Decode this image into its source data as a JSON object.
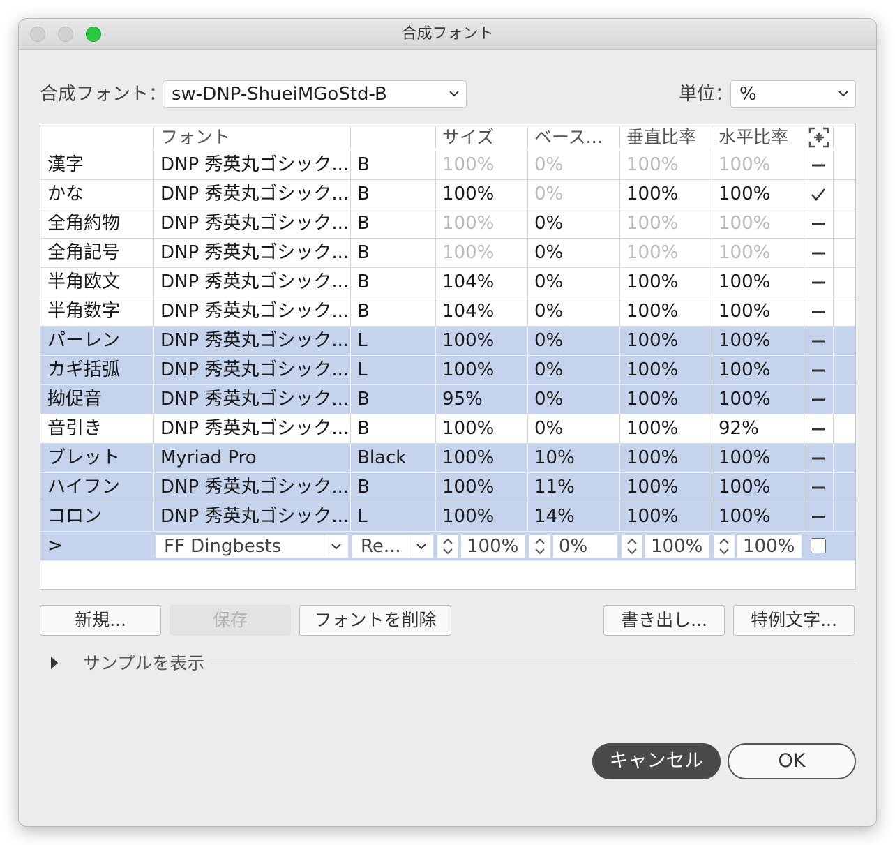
{
  "window": {
    "title": "合成フォント"
  },
  "top": {
    "composite_label": "合成フォント：",
    "composite_value": "sw-DNP-ShueiMGoStd-B",
    "unit_label": "単位：",
    "unit_value": "%"
  },
  "table": {
    "headers": [
      "",
      "フォント",
      "",
      "サイズ",
      "ベース...",
      "垂直比率",
      "水平比率"
    ],
    "rows": [
      {
        "name": "漢字",
        "font": "DNP 秀英丸ゴシック...",
        "style": "B",
        "size": "100%",
        "base": "0%",
        "vscale": "100%",
        "hscale": "100%",
        "mark": "dash",
        "size_dim": true,
        "base_dim": true,
        "vscale_dim": true,
        "hscale_dim": true,
        "selected": false
      },
      {
        "name": "かな",
        "font": "DNP 秀英丸ゴシック...",
        "style": "B",
        "size": "100%",
        "base": "0%",
        "vscale": "100%",
        "hscale": "100%",
        "mark": "check",
        "size_dim": false,
        "base_dim": true,
        "vscale_dim": false,
        "hscale_dim": false,
        "selected": false
      },
      {
        "name": "全角約物",
        "font": "DNP 秀英丸ゴシック...",
        "style": "B",
        "size": "100%",
        "base": "0%",
        "vscale": "100%",
        "hscale": "100%",
        "mark": "dash",
        "size_dim": true,
        "base_dim": false,
        "vscale_dim": true,
        "hscale_dim": true,
        "selected": false
      },
      {
        "name": "全角記号",
        "font": "DNP 秀英丸ゴシック...",
        "style": "B",
        "size": "100%",
        "base": "0%",
        "vscale": "100%",
        "hscale": "100%",
        "mark": "dash",
        "size_dim": true,
        "base_dim": false,
        "vscale_dim": true,
        "hscale_dim": true,
        "selected": false
      },
      {
        "name": "半角欧文",
        "font": "DNP 秀英丸ゴシック...",
        "style": "B",
        "size": "104%",
        "base": "0%",
        "vscale": "100%",
        "hscale": "100%",
        "mark": "dash",
        "size_dim": false,
        "base_dim": false,
        "vscale_dim": false,
        "hscale_dim": false,
        "selected": false
      },
      {
        "name": "半角数字",
        "font": "DNP 秀英丸ゴシック...",
        "style": "B",
        "size": "104%",
        "base": "0%",
        "vscale": "100%",
        "hscale": "100%",
        "mark": "dash",
        "size_dim": false,
        "base_dim": false,
        "vscale_dim": false,
        "hscale_dim": false,
        "selected": false
      },
      {
        "name": "パーレン",
        "font": "DNP 秀英丸ゴシック...",
        "style": "L",
        "size": "100%",
        "base": "0%",
        "vscale": "100%",
        "hscale": "100%",
        "mark": "dash",
        "size_dim": false,
        "base_dim": false,
        "vscale_dim": false,
        "hscale_dim": false,
        "selected": true
      },
      {
        "name": "カギ括弧",
        "font": "DNP 秀英丸ゴシック...",
        "style": "L",
        "size": "100%",
        "base": "0%",
        "vscale": "100%",
        "hscale": "100%",
        "mark": "dash",
        "size_dim": false,
        "base_dim": false,
        "vscale_dim": false,
        "hscale_dim": false,
        "selected": true
      },
      {
        "name": "拗促音",
        "font": "DNP 秀英丸ゴシック...",
        "style": "B",
        "size": "95%",
        "base": "0%",
        "vscale": "100%",
        "hscale": "100%",
        "mark": "dash",
        "size_dim": false,
        "base_dim": false,
        "vscale_dim": false,
        "hscale_dim": false,
        "selected": true
      },
      {
        "name": "音引き",
        "font": "DNP 秀英丸ゴシック...",
        "style": "B",
        "size": "100%",
        "base": "0%",
        "vscale": "100%",
        "hscale": "92%",
        "mark": "dash",
        "size_dim": false,
        "base_dim": false,
        "vscale_dim": false,
        "hscale_dim": false,
        "selected": false
      },
      {
        "name": "ブレット",
        "font": "Myriad Pro",
        "style": "Black",
        "size": "100%",
        "base": "10%",
        "vscale": "100%",
        "hscale": "100%",
        "mark": "dash",
        "size_dim": false,
        "base_dim": false,
        "vscale_dim": false,
        "hscale_dim": false,
        "selected": true
      },
      {
        "name": "ハイフン",
        "font": "DNP 秀英丸ゴシック...",
        "style": "B",
        "size": "100%",
        "base": "11%",
        "vscale": "100%",
        "hscale": "100%",
        "mark": "dash",
        "size_dim": false,
        "base_dim": false,
        "vscale_dim": false,
        "hscale_dim": false,
        "selected": true
      },
      {
        "name": "コロン",
        "font": "DNP 秀英丸ゴシック...",
        "style": "L",
        "size": "100%",
        "base": "14%",
        "vscale": "100%",
        "hscale": "100%",
        "mark": "dash",
        "size_dim": false,
        "base_dim": false,
        "vscale_dim": false,
        "hscale_dim": false,
        "selected": true
      }
    ],
    "edit_row": {
      "name": ">",
      "font": "FF Dingbests",
      "style": "Re...",
      "size": "100%",
      "base": "0%",
      "vscale": "100%",
      "hscale": "100%"
    }
  },
  "buttons": {
    "new": "新規...",
    "save": "保存",
    "delete_font": "フォントを削除",
    "export": "書き出し...",
    "custom_chars": "特例文字..."
  },
  "sample": {
    "label": "サンプルを表示"
  },
  "footer": {
    "cancel": "キャンセル",
    "ok": "OK"
  }
}
